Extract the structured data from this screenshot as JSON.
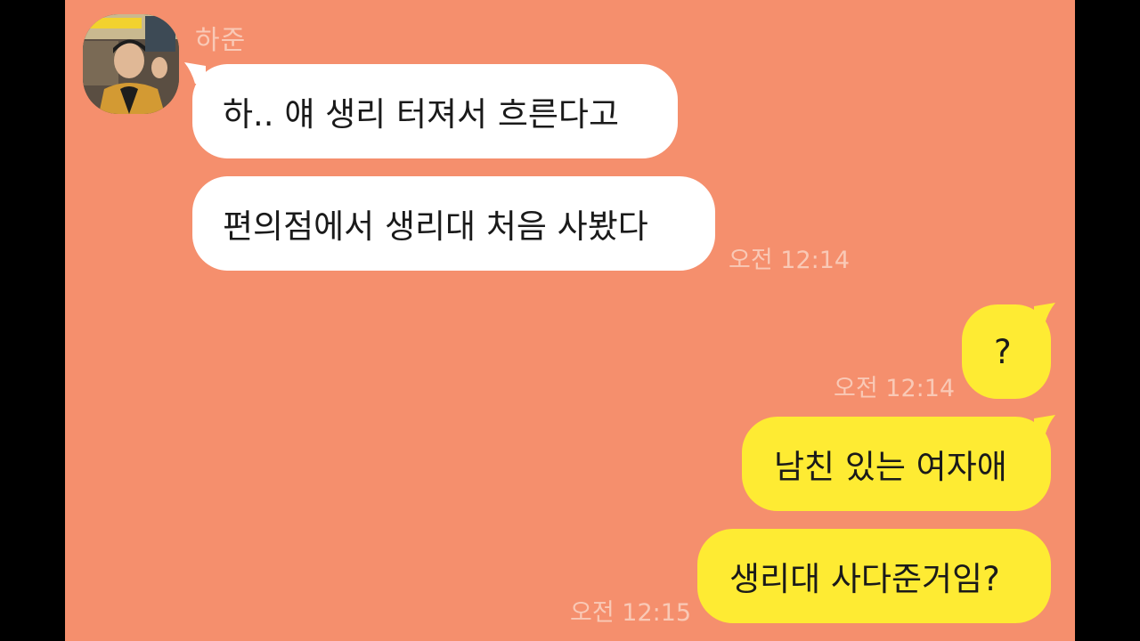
{
  "chat": {
    "sender": "하준",
    "incoming": [
      {
        "text": "하.. 얘 생리 터져서 흐른다고"
      },
      {
        "text": "편의점에서 생리대 처음 사봤다",
        "time": "오전 12:14"
      }
    ],
    "outgoing": [
      {
        "text": "?",
        "time": "오전 12:14"
      },
      {
        "text": "남친 있는 여자애"
      },
      {
        "text": "생리대 사다준거임?",
        "time": "오전 12:15"
      }
    ]
  },
  "colors": {
    "background": "#F58F6D",
    "incoming_bubble": "#FFFFFF",
    "outgoing_bubble": "#FEEB33",
    "meta_text": "#F9C9B6",
    "letterbox": "#000000"
  },
  "icons": {
    "avatar": "profile-photo"
  }
}
